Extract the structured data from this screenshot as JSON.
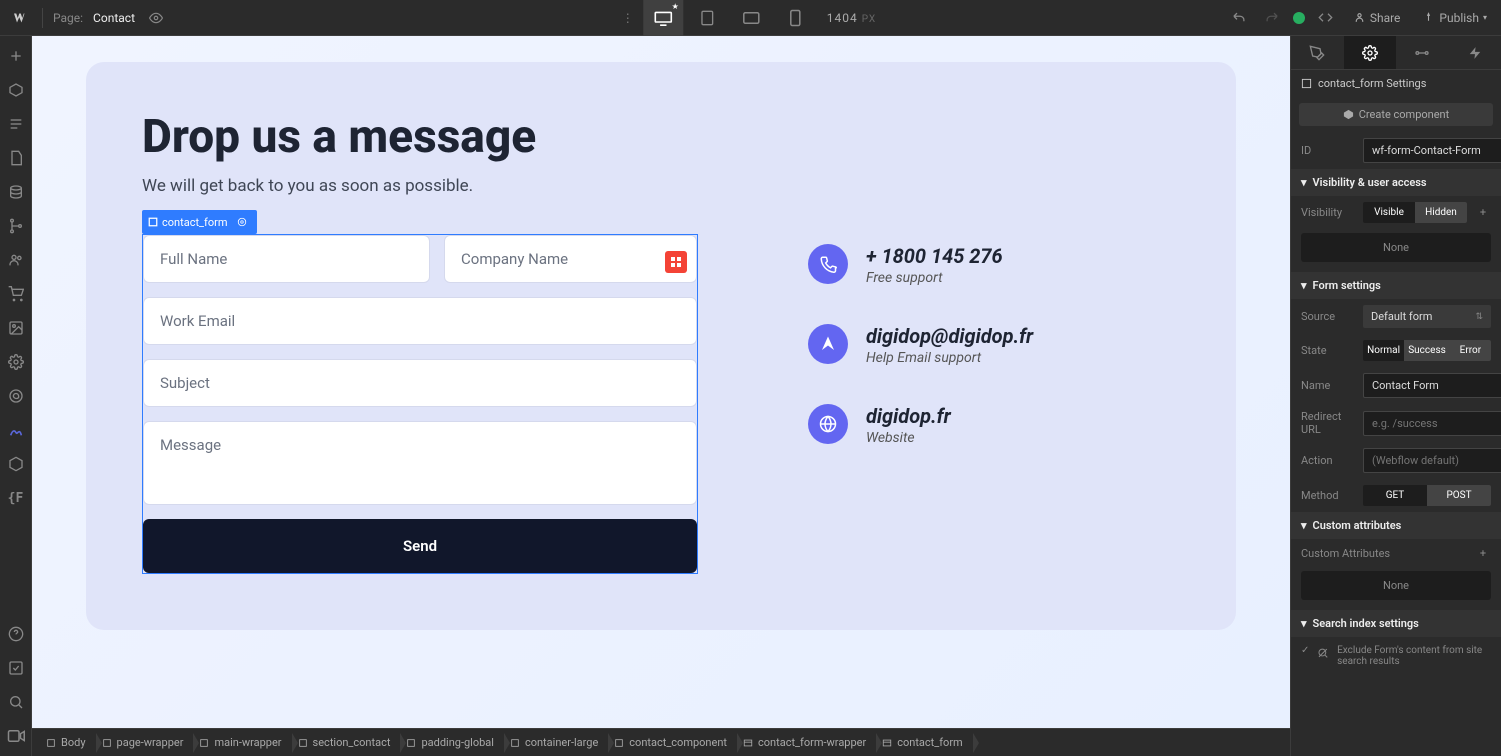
{
  "topbar": {
    "page_label": "Page:",
    "page_name": "Contact",
    "canvas_width": "1404",
    "canvas_unit": "PX",
    "share": "Share",
    "publish": "Publish"
  },
  "canvas": {
    "title": "Drop us a message",
    "subtitle": "We will get back to you as soon as possible.",
    "form_tag": "contact_form",
    "placeholders": {
      "full_name": "Full Name",
      "company": "Company Name",
      "email": "Work Email",
      "subject": "Subject",
      "message": "Message"
    },
    "send_label": "Send",
    "info": [
      {
        "title": "+ 1800 145 276",
        "sub": "Free support"
      },
      {
        "title": "digidop@digidop.fr",
        "sub": "Help Email support"
      },
      {
        "title": "digidop.fr",
        "sub": "Website"
      }
    ]
  },
  "breadcrumbs": [
    "Body",
    "page-wrapper",
    "main-wrapper",
    "section_contact",
    "padding-global",
    "container-large",
    "contact_component",
    "contact_form-wrapper",
    "contact_form"
  ],
  "panel": {
    "element_settings_label": "contact_form Settings",
    "create_component": "Create component",
    "id_label": "ID",
    "id_value": "wf-form-Contact-Form",
    "visibility_header": "Visibility & user access",
    "visibility_label": "Visibility",
    "visible": "Visible",
    "hidden": "Hidden",
    "none": "None",
    "form_settings_header": "Form settings",
    "source_label": "Source",
    "source_value": "Default form",
    "state_label": "State",
    "state_normal": "Normal",
    "state_success": "Success",
    "state_error": "Error",
    "name_label": "Name",
    "name_value": "Contact Form",
    "redirect_label": "Redirect URL",
    "redirect_placeholder": "e.g. /success",
    "action_label": "Action",
    "action_placeholder": "(Webflow default)",
    "method_label": "Method",
    "method_get": "GET",
    "method_post": "POST",
    "custom_attrs_header": "Custom attributes",
    "custom_attrs_label": "Custom Attributes",
    "search_index_header": "Search index settings",
    "exclude_text": "Exclude Form's content from site search results"
  }
}
